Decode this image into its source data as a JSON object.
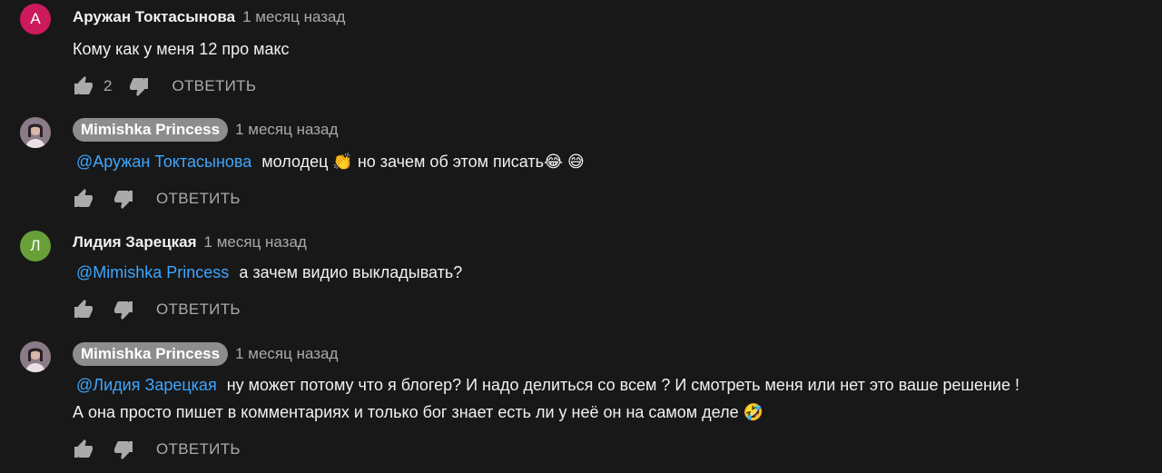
{
  "reply_label": "ОТВЕТИТЬ",
  "colors": {
    "background": "#181818",
    "mention": "#3ea6ff",
    "chip": "#8d8d8d",
    "avatar_a": "#cc1a5c",
    "avatar_l": "#689f38"
  },
  "comments": [
    {
      "author": "Аружан Токтасынова",
      "time": "1 месяц назад",
      "avatar_letter": "А",
      "text": "Кому как у меня 12 про макс",
      "likes": "2"
    },
    {
      "author": "Mimishka Princess",
      "time": "1 месяц назад",
      "mention": "@Аружан Токтасынова",
      "text": "молодец 👏  но зачем об этом писать😂 😅"
    },
    {
      "author": "Лидия Зарецкая",
      "time": "1 месяц назад",
      "avatar_letter": "Л",
      "mention": "@Mimishka Princess",
      "text": "а зачем видио выкладывать?"
    },
    {
      "author": "Mimishka Princess",
      "time": "1 месяц назад",
      "mention": "@Лидия Зарецкая",
      "text": "ну может потому что я блогер? И надо делиться со всем ? И смотреть меня или нет это ваше решение !",
      "text2": "А она просто пишет в комментариях и только бог знает есть ли у неё он на самом деле 🤣"
    }
  ]
}
